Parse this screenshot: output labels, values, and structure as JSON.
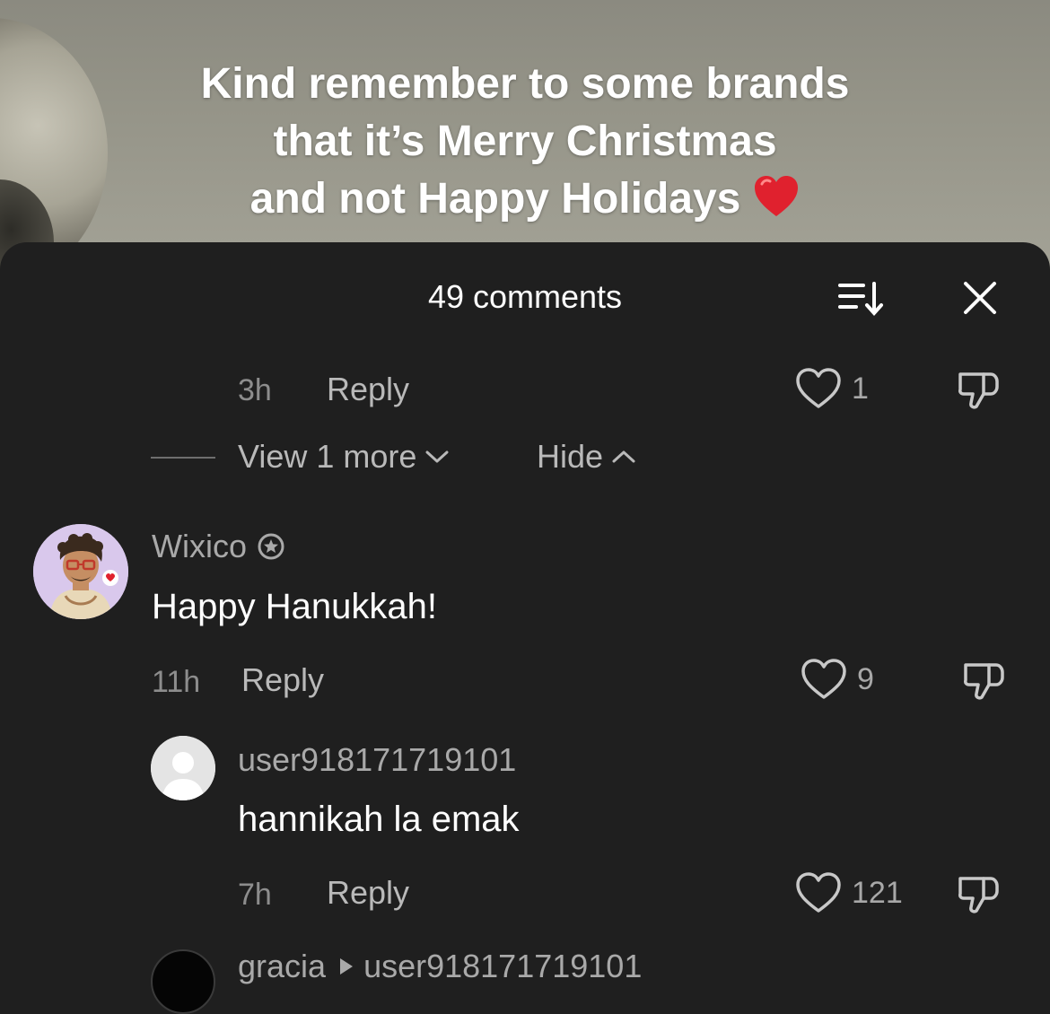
{
  "video": {
    "caption_lines": [
      "Kind remember to some brands",
      "that it’s Merry Christmas",
      "and not Happy Holidays"
    ],
    "caption_emoji": "heart-emoji"
  },
  "sheet": {
    "title": "49 comments",
    "sort_icon": "sort-icon",
    "close_icon": "close-icon"
  },
  "colors": {
    "sheet_bg": "#1f1f1f",
    "text_primary": "#ffffff",
    "text_secondary": "#a9a9a9",
    "emoji_heart": "#e0212e"
  },
  "prev_reply": {
    "time": "3h",
    "reply_label": "Reply",
    "likes": "1"
  },
  "thread_controls": {
    "view_more": "View 1 more",
    "hide": "Hide"
  },
  "comment": {
    "username": "Wixico",
    "badge_icon": "star-badge-icon",
    "text": "Happy Hanukkah!",
    "time": "11h",
    "reply_label": "Reply",
    "likes": "9"
  },
  "reply": {
    "username": "user918171719101",
    "text": "hannikah la emak",
    "time": "7h",
    "reply_label": "Reply",
    "likes": "121"
  },
  "next_reply": {
    "username": "gracia",
    "reply_to": "user918171719101"
  }
}
